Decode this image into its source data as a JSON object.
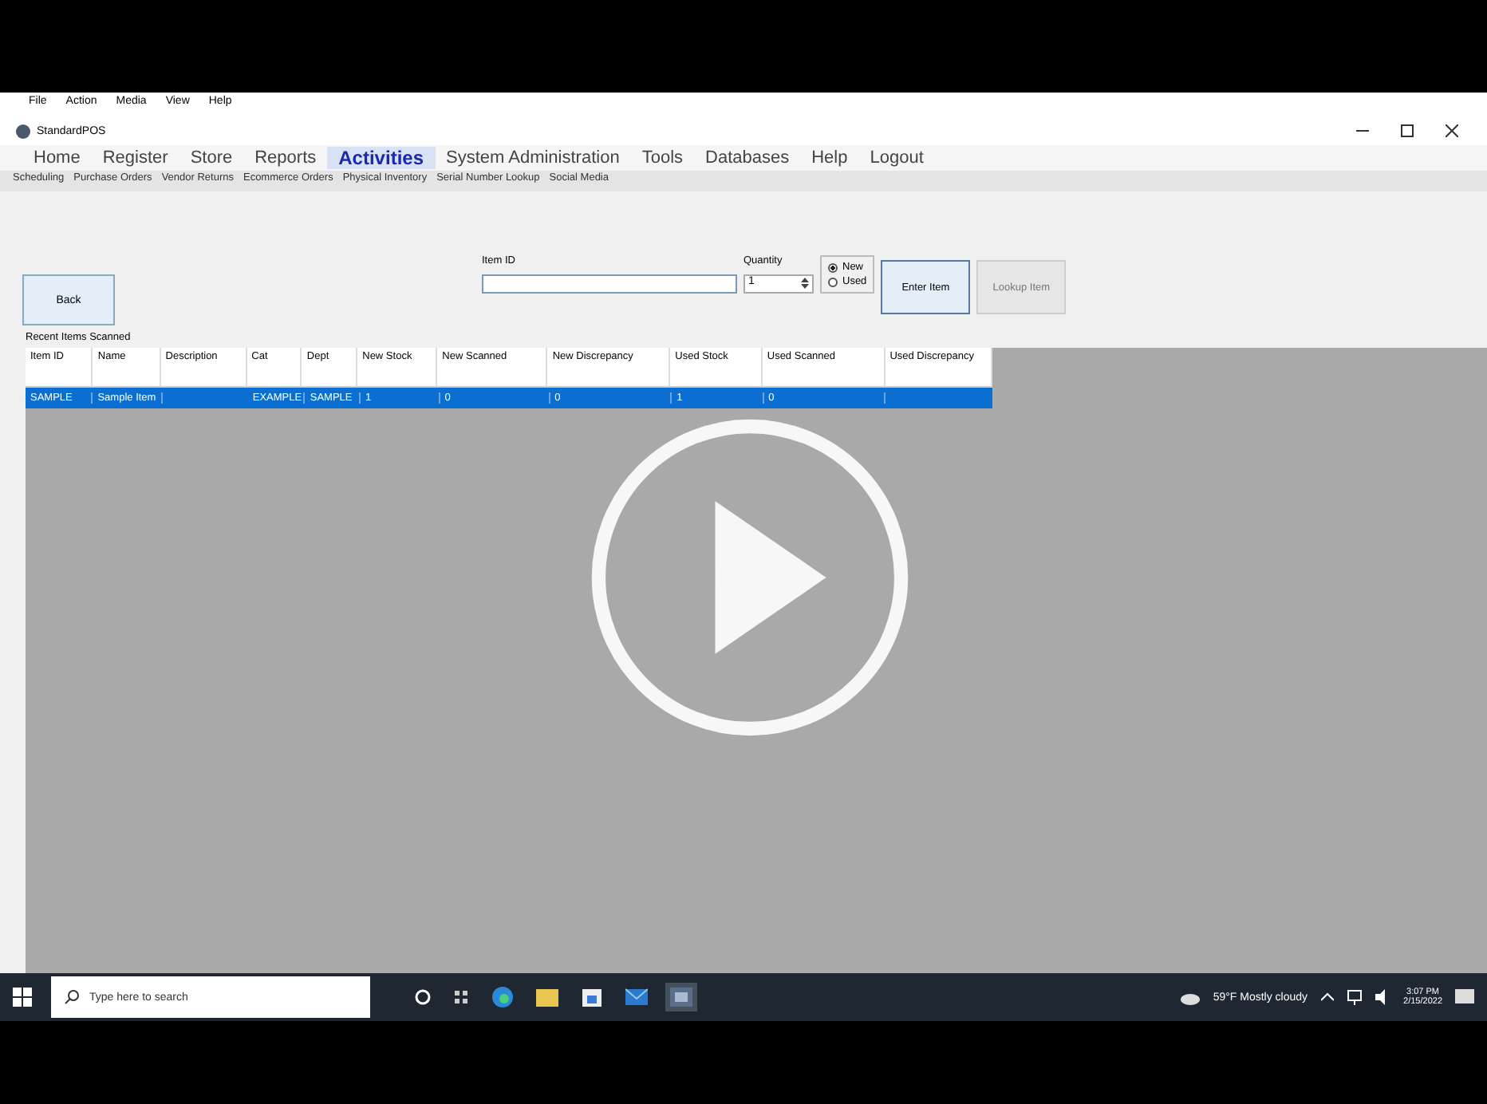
{
  "menu_bar": [
    "File",
    "Action",
    "Media",
    "View",
    "Help"
  ],
  "window": {
    "title": "StandardPOS"
  },
  "main_tabs": [
    {
      "label": "Home",
      "selected": false
    },
    {
      "label": "Register",
      "selected": false
    },
    {
      "label": "Store",
      "selected": false
    },
    {
      "label": "Reports",
      "selected": false
    },
    {
      "label": "Activities",
      "selected": true
    },
    {
      "label": "System Administration",
      "selected": false
    },
    {
      "label": "Tools",
      "selected": false
    },
    {
      "label": "Databases",
      "selected": false
    },
    {
      "label": "Help",
      "selected": false
    },
    {
      "label": "Logout",
      "selected": false
    }
  ],
  "sub_tabs": [
    "Scheduling",
    "Purchase Orders",
    "Vendor Returns",
    "Ecommerce Orders",
    "Physical Inventory",
    "Serial Number Lookup",
    "Social Media"
  ],
  "back_button": "Back",
  "item_id": {
    "label": "Item ID"
  },
  "quantity": {
    "label": "Quantity",
    "value": "1"
  },
  "condition": [
    {
      "label": "New",
      "selected": true
    },
    {
      "label": "Used",
      "selected": false
    }
  ],
  "buttons": [
    {
      "label": "Enter Item",
      "disabled": false
    },
    {
      "label": "Lookup Item",
      "disabled": true
    }
  ],
  "table": {
    "title": "Recent Items Scanned",
    "columns": [
      "Item ID",
      "Name",
      "Description",
      "Cat",
      "Dept",
      "New Stock",
      "New Scanned",
      "New Discrepancy",
      "Used Stock",
      "Used Scanned",
      "Used Discrepancy"
    ],
    "rows": [
      {
        "selected": true,
        "cells": [
          "SAMPLE",
          "Sample Item",
          "",
          "EXAMPLE",
          "SAMPLE",
          "1",
          "0",
          "0",
          "1",
          "0",
          ""
        ]
      }
    ]
  },
  "taskbar": {
    "search_placeholder": "Type here to search",
    "weather": "59°F  Mostly cloudy",
    "time": "3:07 PM",
    "date": "2/15/2022"
  }
}
